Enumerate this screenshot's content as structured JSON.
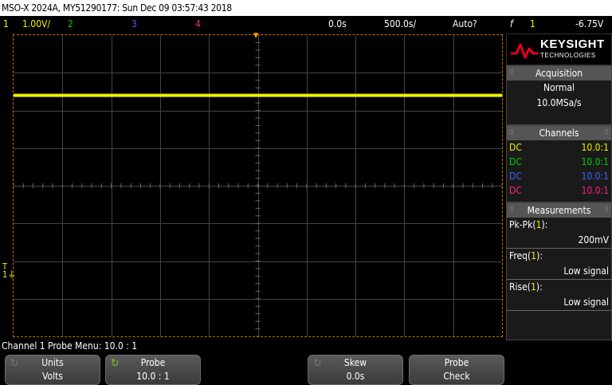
{
  "title_bar": "MSO-X 2024A, MY51290177: Sun Dec 09 03:57:43 2018",
  "status": {
    "ch1_num": "1",
    "ch1_scale": "1.00V/",
    "ch2_num": "2",
    "ch3_num": "3",
    "ch4_num": "4",
    "delay": "0.0s",
    "timebase": "500.0s/",
    "trigger_mode": "Auto?",
    "trigger_icon": "f",
    "trigger_src": "1",
    "trigger_level": "-6.75V"
  },
  "colors": {
    "ch1": "#f0f000",
    "ch2": "#00d000",
    "ch3": "#4060ff",
    "ch4": "#ff2080",
    "grid": "#444444",
    "frame": "#c87000",
    "brand": "#e8001c"
  },
  "logo": {
    "name": "KEYSIGHT",
    "sub": "TECHNOLOGIES"
  },
  "acquisition": {
    "header": "Acquisition",
    "mode": "Normal",
    "rate": "10.0MSa/s"
  },
  "channels": {
    "header": "Channels",
    "rows": [
      {
        "coupling": "DC",
        "probe": "10.0:1"
      },
      {
        "coupling": "DC",
        "probe": "10.0:1"
      },
      {
        "coupling": "DC",
        "probe": "10.0:1"
      },
      {
        "coupling": "DC",
        "probe": "10.0:1"
      }
    ]
  },
  "measurements": {
    "header": "Measurements",
    "items": [
      {
        "name": "Pk-Pk",
        "src": "1",
        "value": "200mV"
      },
      {
        "name": "Freq",
        "src": "1",
        "value": "Low signal"
      },
      {
        "name": "Rise",
        "src": "1",
        "value": "Low signal"
      }
    ]
  },
  "softkey_menu_label": "Channel 1 Probe Menu: 10.0 : 1",
  "softkeys": {
    "units": {
      "label": "Units",
      "value": "Volts"
    },
    "probe": {
      "label": "Probe",
      "value": "10.0 : 1"
    },
    "skew": {
      "label": "Skew",
      "value": "0.0s"
    },
    "probe_check": {
      "label": "Probe",
      "value": "Check"
    }
  },
  "trace": {
    "level_fraction": 0.2
  }
}
